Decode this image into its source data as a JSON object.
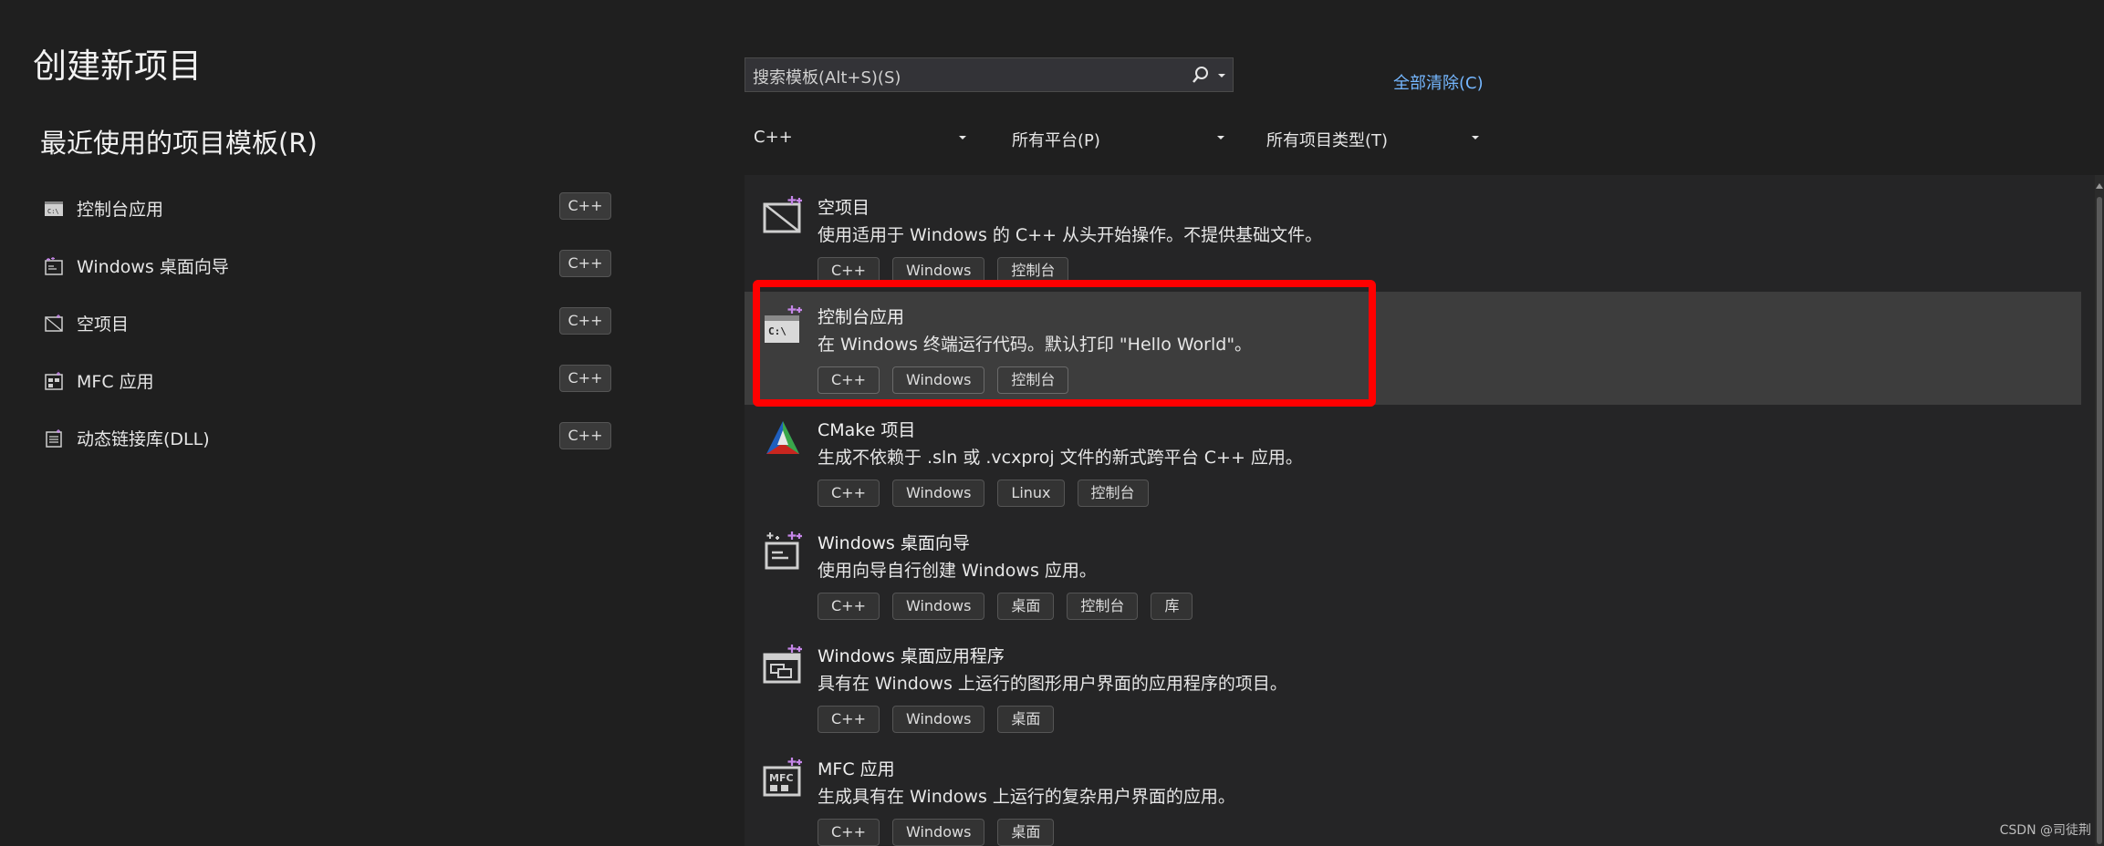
{
  "page_title": "创建新项目",
  "recent": {
    "title": "最近使用的项目模板(R)",
    "items": [
      {
        "label": "控制台应用",
        "tag": "C++",
        "icon": "console-app-icon"
      },
      {
        "label": "Windows 桌面向导",
        "tag": "C++",
        "icon": "desktop-wizard-icon"
      },
      {
        "label": "空项目",
        "tag": "C++",
        "icon": "empty-project-icon"
      },
      {
        "label": "MFC 应用",
        "tag": "C++",
        "icon": "mfc-app-icon"
      },
      {
        "label": "动态链接库(DLL)",
        "tag": "C++",
        "icon": "dll-icon"
      }
    ]
  },
  "search": {
    "placeholder": "搜索模板(Alt+S)(S)",
    "icon": "search-icon"
  },
  "clear_all": "全部清除(C)",
  "filters": {
    "language": "C++",
    "platform": "所有平台(P)",
    "project_type": "所有项目类型(T)"
  },
  "templates": [
    {
      "name": "空项目",
      "desc": "使用适用于 Windows 的 C++ 从头开始操作。不提供基础文件。",
      "tags": [
        "C++",
        "Windows",
        "控制台"
      ],
      "icon": "empty-project-icon",
      "selected": false
    },
    {
      "name": "控制台应用",
      "desc": "在 Windows 终端运行代码。默认打印 \"Hello World\"。",
      "tags": [
        "C++",
        "Windows",
        "控制台"
      ],
      "icon": "console-app-icon",
      "selected": true
    },
    {
      "name": "CMake 项目",
      "desc": "生成不依赖于 .sln 或 .vcxproj 文件的新式跨平台 C++ 应用。",
      "tags": [
        "C++",
        "Windows",
        "Linux",
        "控制台"
      ],
      "icon": "cmake-icon",
      "selected": false
    },
    {
      "name": "Windows 桌面向导",
      "desc": "使用向导自行创建 Windows 应用。",
      "tags": [
        "C++",
        "Windows",
        "桌面",
        "控制台",
        "库"
      ],
      "icon": "desktop-wizard-icon",
      "selected": false
    },
    {
      "name": "Windows 桌面应用程序",
      "desc": "具有在 Windows 上运行的图形用户界面的应用程序的项目。",
      "tags": [
        "C++",
        "Windows",
        "桌面"
      ],
      "icon": "desktop-app-icon",
      "selected": false
    },
    {
      "name": "MFC 应用",
      "desc": "生成具有在 Windows 上运行的复杂用户界面的应用。",
      "tags": [
        "C++",
        "Windows",
        "桌面"
      ],
      "icon": "mfc-app-icon",
      "selected": false
    }
  ],
  "icon_text": {
    "console": "C:\\",
    "mfc": "MFC"
  },
  "watermark": "CSDN @司徒荆",
  "colors": {
    "background": "#1f1f1f",
    "list_background": "#252526",
    "selected_row": "#3d3d3d",
    "link": "#75b7ff",
    "highlight": "#ff0000",
    "plus_accent": "#c586e8"
  }
}
